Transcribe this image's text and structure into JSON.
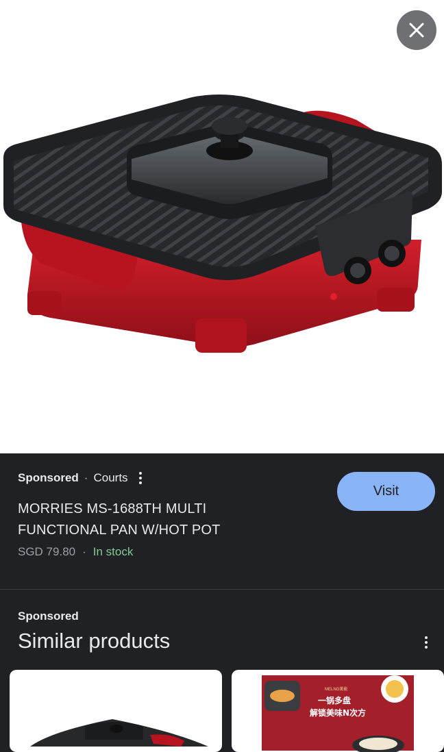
{
  "hero": {
    "close_icon": "close-icon"
  },
  "listing": {
    "sponsored_label": "Sponsored",
    "separator": "·",
    "seller": "Courts",
    "title": "MORRIES MS-1688TH MULTI FUNCTIONAL PAN W/HOT POT",
    "price": "SGD 79.80",
    "price_separator": "·",
    "stock_status": "In stock",
    "visit_label": "Visit"
  },
  "similar": {
    "sponsored_label": "Sponsored",
    "title": "Similar products",
    "items": [
      {
        "kind": "grill-pan-thumbnail"
      },
      {
        "kind": "promo-thumbnail",
        "brand": "MELNG美能",
        "line1": "一锅多盘",
        "line2": "解锁美味N次方"
      }
    ]
  },
  "colors": {
    "background": "#202124",
    "accent_button": "#8ab4f8",
    "stock_green": "#81c995",
    "product_red": "#b5141f"
  }
}
